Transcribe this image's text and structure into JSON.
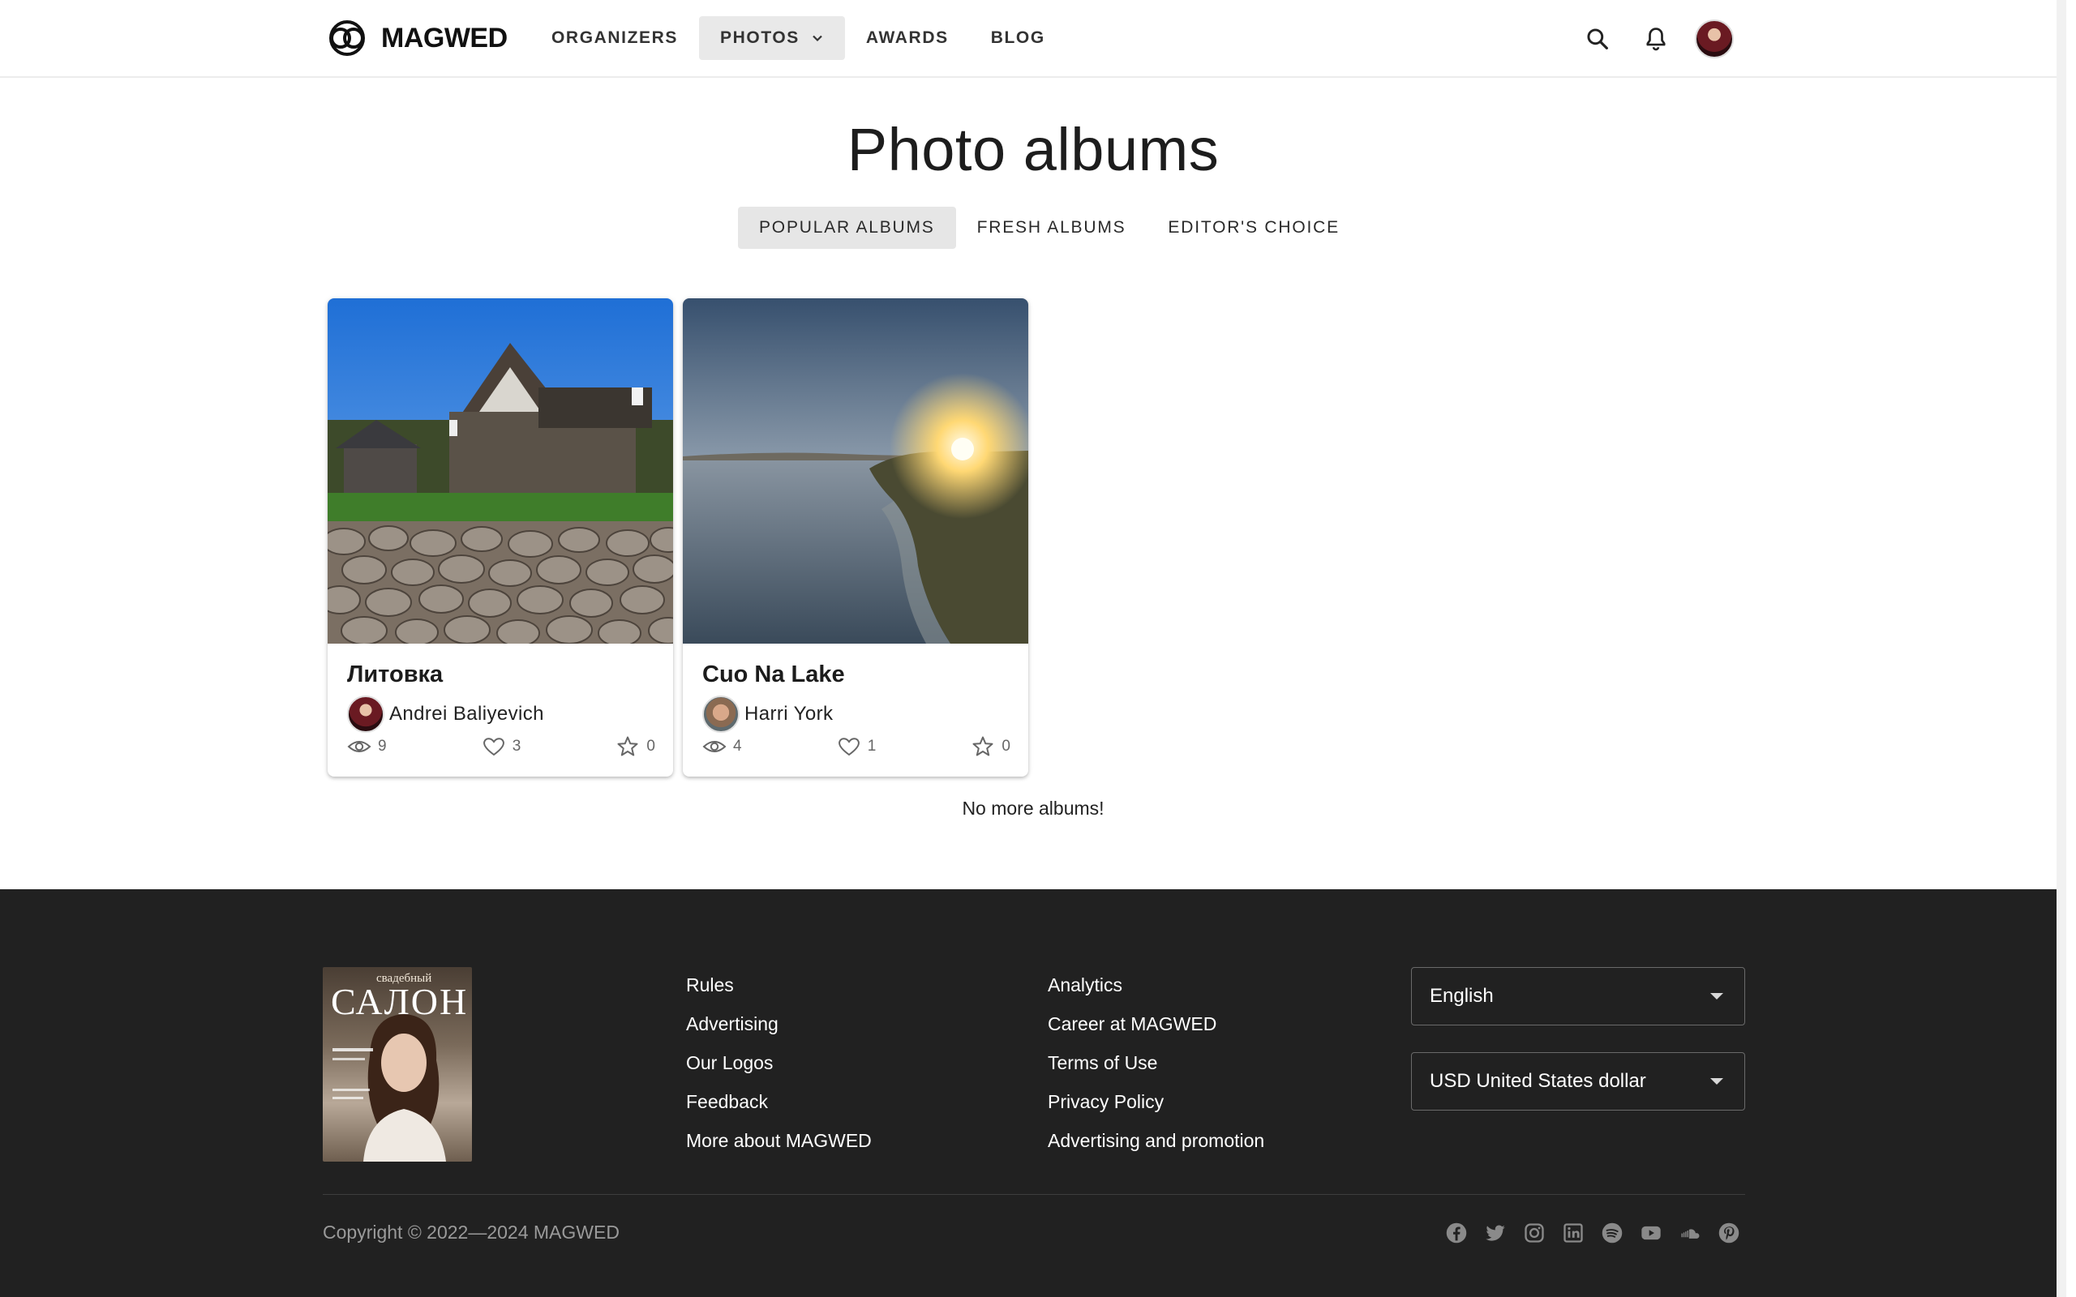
{
  "header": {
    "logo_text": "MAGWED",
    "nav": [
      {
        "label": "ORGANIZERS"
      },
      {
        "label": "PHOTOS"
      },
      {
        "label": "AWARDS"
      },
      {
        "label": "BLOG"
      }
    ],
    "icons": [
      "search-icon",
      "bell-icon"
    ]
  },
  "main": {
    "title": "Photo albums",
    "tabs": [
      {
        "label": "POPULAR ALBUMS"
      },
      {
        "label": "FRESH ALBUMS"
      },
      {
        "label": "EDITOR'S CHOICE"
      }
    ],
    "albums": [
      {
        "title": "Литовка",
        "author": "Andrei Baliyevich",
        "views": "9",
        "likes": "3",
        "stars": "0"
      },
      {
        "title": "Cuo Na Lake",
        "author": "Harri York",
        "views": "4",
        "likes": "1",
        "stars": "0"
      }
    ],
    "no_more": "No more albums!"
  },
  "footer": {
    "col1": [
      "Rules",
      "Advertising",
      "Our Logos",
      "Feedback",
      "More about MAGWED"
    ],
    "col2": [
      "Analytics",
      "Career at MAGWED",
      "Terms of Use",
      "Privacy Policy",
      "Advertising and promotion"
    ],
    "language": "English",
    "currency": "USD United States dollar",
    "copyright": "Copyright © 2022—2024 MAGWED",
    "magazine": {
      "title": "САЛОН",
      "subtitle": "свадебный"
    },
    "socials": [
      "facebook-icon",
      "twitter-icon",
      "instagram-icon",
      "linkedin-icon",
      "spotify-icon",
      "youtube-icon",
      "soundcloud-icon",
      "pinterest-icon"
    ]
  },
  "colors": {
    "footer_bg": "#212121",
    "active_tab_bg": "#e6e6e6"
  }
}
